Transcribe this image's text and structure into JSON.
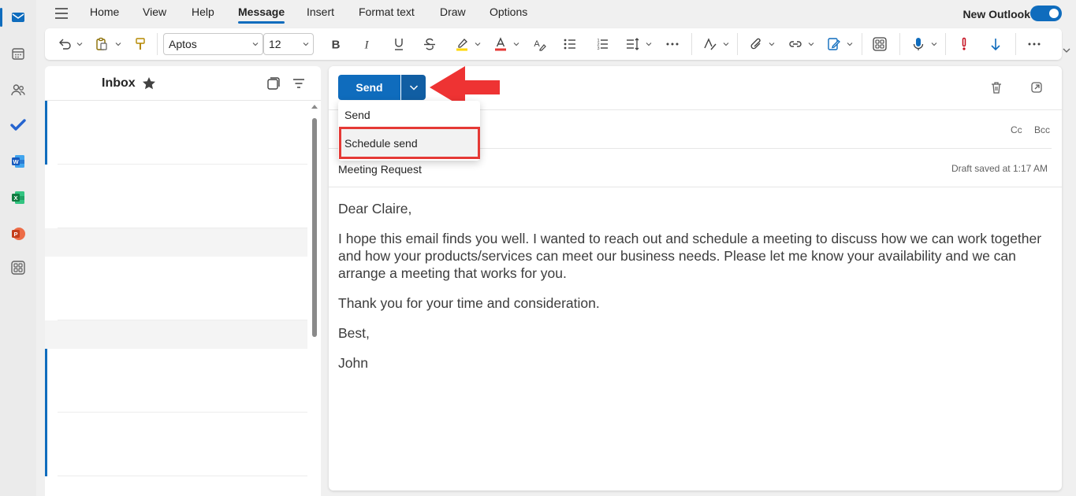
{
  "colors": {
    "accent": "#0f6cbd",
    "highlight": "#e53935"
  },
  "menu": {
    "tabs": [
      "Home",
      "View",
      "Help",
      "Message",
      "Insert",
      "Format text",
      "Draw",
      "Options"
    ],
    "active_tab": "Message",
    "new_outlook_label": "New Outlook"
  },
  "ribbon": {
    "font_name": "Aptos",
    "font_size": "12"
  },
  "rail": {
    "items": [
      "mail-icon",
      "calendar-icon",
      "people-icon",
      "todo-icon",
      "word-icon",
      "excel-icon",
      "powerpoint-icon",
      "apps-icon"
    ]
  },
  "inbox": {
    "title": "Inbox"
  },
  "compose": {
    "send_label": "Send",
    "cc_label": "Cc",
    "bcc_label": "Bcc",
    "subject": "Meeting Request",
    "draft_status": "Draft saved at 1:17 AM",
    "body": {
      "greeting": "Dear Claire,",
      "paragraph1": "I hope this email finds you well. I wanted to reach out and schedule a meeting to discuss how we can work together and how your products/services can meet our business needs. Please let me know your availability and we can arrange a meeting that works for you.",
      "paragraph2": "Thank you for your time and consideration.",
      "closing": "Best,",
      "signature": "John"
    }
  },
  "send_menu": {
    "items": [
      "Send",
      "Schedule send"
    ],
    "highlighted": "Schedule send"
  }
}
